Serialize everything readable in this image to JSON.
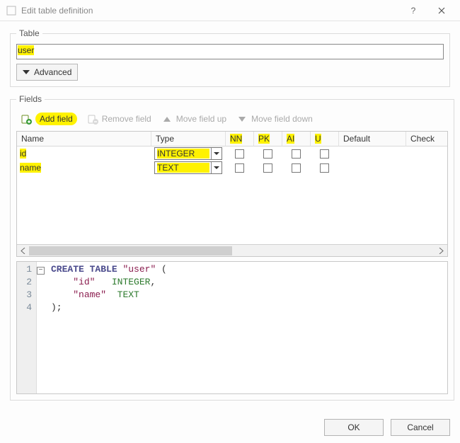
{
  "window": {
    "title": "Edit table definition"
  },
  "table": {
    "legend": "Table",
    "name": "user",
    "advanced_label": "Advanced"
  },
  "fields": {
    "legend": "Fields",
    "toolbar": {
      "add": "Add field",
      "remove": "Remove field",
      "up": "Move field up",
      "down": "Move field down"
    },
    "columns": {
      "name": "Name",
      "type": "Type",
      "nn": "NN",
      "pk": "PK",
      "ai": "AI",
      "u": "U",
      "default": "Default",
      "check": "Check"
    },
    "rows": [
      {
        "name": "id",
        "type": "INTEGER",
        "nn": false,
        "pk": false,
        "ai": false,
        "u": false,
        "default": "",
        "check": ""
      },
      {
        "name": "name",
        "type": "TEXT",
        "nn": false,
        "pk": false,
        "ai": false,
        "u": false,
        "default": "",
        "check": ""
      }
    ]
  },
  "sql": {
    "l1": "CREATE TABLE",
    "l1b": "\"user\"",
    "l1c": " (",
    "l2a": "\"id\"",
    "l2b": "INTEGER",
    "l2c": ",",
    "l3a": "\"name\"",
    "l3b": "TEXT",
    "l4": ");"
  },
  "buttons": {
    "ok": "OK",
    "cancel": "Cancel"
  }
}
